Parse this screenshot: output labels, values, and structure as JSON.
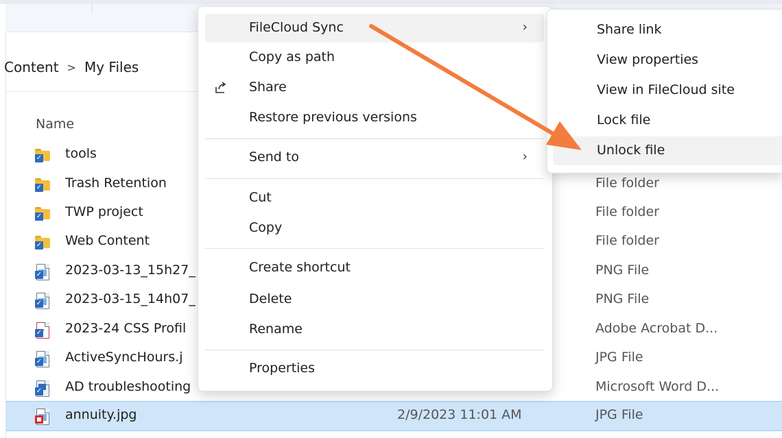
{
  "breadcrumb": {
    "parent": "Content",
    "separator": ">",
    "current": "My Files"
  },
  "columns": {
    "name": "Name"
  },
  "files": [
    {
      "name": "tools",
      "date": "",
      "type": "",
      "icon": "folder-icon"
    },
    {
      "name": "Trash Retention",
      "date": "",
      "type": "File folder",
      "icon": "folder-icon"
    },
    {
      "name": "TWP project",
      "date": "",
      "type": "File folder",
      "icon": "folder-icon"
    },
    {
      "name": "Web Content",
      "date": "",
      "type": "File folder",
      "icon": "folder-icon"
    },
    {
      "name": "2023-03-13_15h27_",
      "date": "",
      "type": "PNG File",
      "icon": "image-file-icon"
    },
    {
      "name": "2023-03-15_14h07_",
      "date": "",
      "type": "PNG File",
      "icon": "image-file-icon"
    },
    {
      "name": "2023-24 CSS Profil",
      "date": "",
      "type": "Adobe Acrobat D...",
      "icon": "pdf-file-icon"
    },
    {
      "name": "ActiveSyncHours.j",
      "date": "",
      "type": "JPG File",
      "icon": "image-file-icon"
    },
    {
      "name": "AD troubleshooting",
      "date": "",
      "type": "Microsoft Word D...",
      "icon": "word-file-icon"
    },
    {
      "name": "annuity.jpg",
      "date": "2/9/2023 11:01 AM",
      "type": "JPG File",
      "icon": "locked-file-icon"
    }
  ],
  "context_menu": {
    "items": [
      {
        "label": "FileCloud Sync",
        "has_submenu": true
      },
      {
        "label": "Copy as path"
      },
      {
        "label": "Share",
        "icon": "share-icon"
      },
      {
        "label": "Restore previous versions"
      },
      {
        "label": "Send to",
        "has_submenu": true
      },
      {
        "label": "Cut"
      },
      {
        "label": "Copy"
      },
      {
        "label": "Create shortcut"
      },
      {
        "label": "Delete"
      },
      {
        "label": "Rename"
      },
      {
        "label": "Properties"
      }
    ],
    "submenu_arrow": "›"
  },
  "submenu": {
    "items": [
      {
        "label": "Share link"
      },
      {
        "label": "View properties"
      },
      {
        "label": "View in FileCloud site"
      },
      {
        "label": "Lock file"
      },
      {
        "label": "Unlock file"
      }
    ]
  },
  "colors": {
    "annotation_arrow": "#f47c3c",
    "selection": "#cfe5fa",
    "folder": "#f4bf3f"
  }
}
